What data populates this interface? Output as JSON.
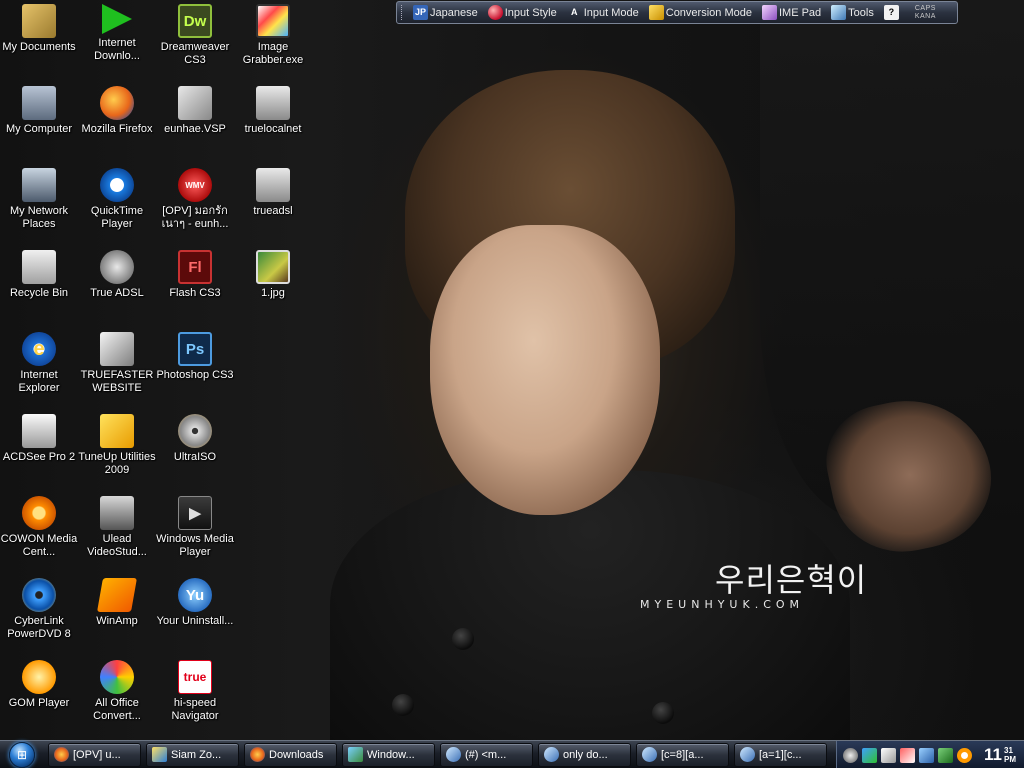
{
  "wallpaper": {
    "watermark_korean": "우리은혁이",
    "watermark_site": "MYEUNHYUK.COM"
  },
  "language_bar": {
    "items": [
      {
        "icon": "jp-language-icon",
        "icon_text": "JP",
        "label": "Japanese"
      },
      {
        "icon": "input-style-icon",
        "label": "Input Style"
      },
      {
        "icon": "input-mode-icon",
        "icon_text": "A",
        "label": "Input Mode"
      },
      {
        "icon": "conversion-mode-icon",
        "label": "Conversion Mode"
      },
      {
        "icon": "ime-pad-icon",
        "label": "IME Pad"
      },
      {
        "icon": "tools-icon",
        "label": "Tools"
      },
      {
        "icon": "help-icon",
        "icon_text": "?",
        "label": ""
      }
    ],
    "caps": "CAPS",
    "kana": "KANA"
  },
  "desktop_icons": [
    {
      "label": "My Documents",
      "icon": "my-documents-icon",
      "glyph": ""
    },
    {
      "label": "Internet Downlo...",
      "icon": "internet-download-manager-icon",
      "glyph": ""
    },
    {
      "label": "Dreamweaver CS3",
      "icon": "dreamweaver-icon",
      "glyph": "Dw"
    },
    {
      "label": "Image Grabber.exe",
      "icon": "image-grabber-icon",
      "glyph": ""
    },
    {
      "label": "My Computer",
      "icon": "my-computer-icon",
      "glyph": ""
    },
    {
      "label": "Mozilla Firefox",
      "icon": "firefox-icon",
      "glyph": ""
    },
    {
      "label": "eunhae.VSP",
      "icon": "vsp-file-icon",
      "glyph": ""
    },
    {
      "label": "truelocalnet",
      "icon": "network-shortcut-icon",
      "glyph": ""
    },
    {
      "label": "My Network Places",
      "icon": "network-places-icon",
      "glyph": ""
    },
    {
      "label": "QuickTime Player",
      "icon": "quicktime-icon",
      "glyph": ""
    },
    {
      "label": "[OPV] มอกรัก เนาๆ - eunh...",
      "icon": "wmv-file-icon",
      "glyph": "WMV"
    },
    {
      "label": "trueadsl",
      "icon": "network-shortcut-icon",
      "glyph": ""
    },
    {
      "label": "Recycle Bin",
      "icon": "recycle-bin-icon",
      "glyph": ""
    },
    {
      "label": "True ADSL",
      "icon": "true-adsl-icon",
      "glyph": ""
    },
    {
      "label": "Flash CS3",
      "icon": "flash-icon",
      "glyph": "Fl"
    },
    {
      "label": "1.jpg",
      "icon": "jpg-file-icon",
      "glyph": ""
    },
    {
      "label": "Internet Explorer",
      "icon": "internet-explorer-icon",
      "glyph": "e"
    },
    {
      "label": "TRUEFASTER WEBSITE",
      "icon": "website-shortcut-icon",
      "glyph": ""
    },
    {
      "label": "Photoshop CS3",
      "icon": "photoshop-icon",
      "glyph": "Ps"
    },
    {
      "label": "",
      "icon": "",
      "glyph": ""
    },
    {
      "label": "ACDSee Pro 2",
      "icon": "acdsee-icon",
      "glyph": ""
    },
    {
      "label": "TuneUp Utilities 2009",
      "icon": "tuneup-icon",
      "glyph": ""
    },
    {
      "label": "UltraISO",
      "icon": "ultraiso-icon",
      "glyph": ""
    },
    {
      "label": "",
      "icon": "",
      "glyph": ""
    },
    {
      "label": "COWON Media Cent...",
      "icon": "cowon-icon",
      "glyph": ""
    },
    {
      "label": "Ulead VideoStud...",
      "icon": "ulead-icon",
      "glyph": ""
    },
    {
      "label": "Windows Media Player",
      "icon": "windows-media-player-icon",
      "glyph": "▶"
    },
    {
      "label": "",
      "icon": "",
      "glyph": ""
    },
    {
      "label": "CyberLink PowerDVD 8",
      "icon": "powerdvd-icon",
      "glyph": ""
    },
    {
      "label": "WinAmp",
      "icon": "winamp-icon",
      "glyph": ""
    },
    {
      "label": "Your Uninstall...",
      "icon": "uninstaller-icon",
      "glyph": "Yu"
    },
    {
      "label": "",
      "icon": "",
      "glyph": ""
    },
    {
      "label": "GOM Player",
      "icon": "gom-player-icon",
      "glyph": ""
    },
    {
      "label": "All Office Convert...",
      "icon": "office-converter-icon",
      "glyph": ""
    },
    {
      "label": "hi-speed Navigator",
      "icon": "true-navigator-icon",
      "glyph": "true"
    }
  ],
  "taskbar": {
    "tasks": [
      {
        "label": "[OPV] u...",
        "icon": "firefox-icon"
      },
      {
        "label": "Siam Zo...",
        "icon": "siamzone-icon"
      },
      {
        "label": "Downloads",
        "icon": "firefox-icon"
      },
      {
        "label": "Window...",
        "icon": "windows-explorer-icon"
      },
      {
        "label": "(#) <m...",
        "icon": "messenger-icon"
      },
      {
        "label": "only do...",
        "icon": "messenger-icon"
      },
      {
        "label": "[c=8][a...",
        "icon": "messenger-icon"
      },
      {
        "label": "[a=1][c...",
        "icon": "messenger-icon"
      }
    ],
    "clock_hour": "11",
    "clock_min": "31",
    "clock_ampm": "PM"
  }
}
